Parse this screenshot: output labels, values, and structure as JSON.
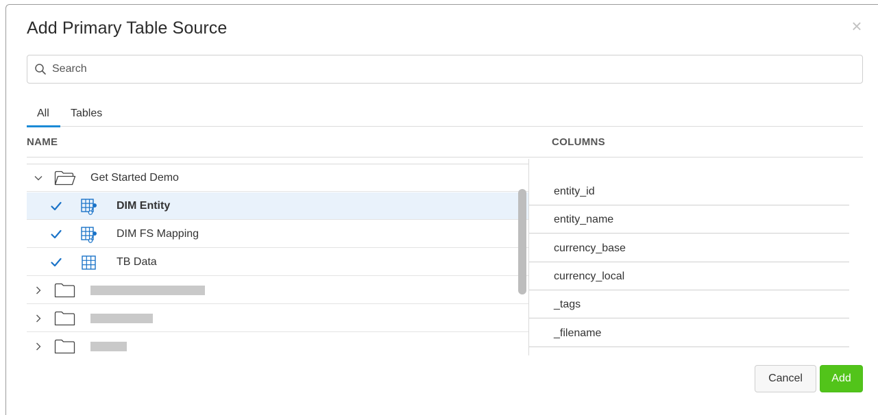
{
  "dialog": {
    "title": "Add Primary Table Source",
    "close_glyph": "×"
  },
  "search": {
    "placeholder": "Search",
    "value": "",
    "icon": "search-icon"
  },
  "tabs": [
    {
      "label": "All",
      "active": true
    },
    {
      "label": "Tables",
      "active": false
    }
  ],
  "columns_header": {
    "name": "NAME",
    "columns": "COLUMNS"
  },
  "tree": {
    "folder": {
      "label": "Get Started Demo",
      "expanded": true
    },
    "tables": [
      {
        "label": "DIM Entity",
        "checked": true,
        "selected": true,
        "icon": "linked-table-icon"
      },
      {
        "label": "DIM FS Mapping",
        "checked": true,
        "selected": false,
        "icon": "linked-table-icon"
      },
      {
        "label": "TB Data",
        "checked": true,
        "selected": false,
        "icon": "table-grid-icon"
      }
    ],
    "collapsed_folders": [
      {
        "label_redacted": true
      },
      {
        "label_redacted": true
      },
      {
        "label_redacted": true
      }
    ]
  },
  "column_list": [
    "entity_id",
    "entity_name",
    "currency_base",
    "currency_local",
    "_tags",
    "_filename"
  ],
  "footer": {
    "cancel_label": "Cancel",
    "add_label": "Add"
  },
  "colors": {
    "accent_blue": "#1a8ad6",
    "add_green": "#52c41a",
    "selected_row": "#e9f2fb"
  }
}
